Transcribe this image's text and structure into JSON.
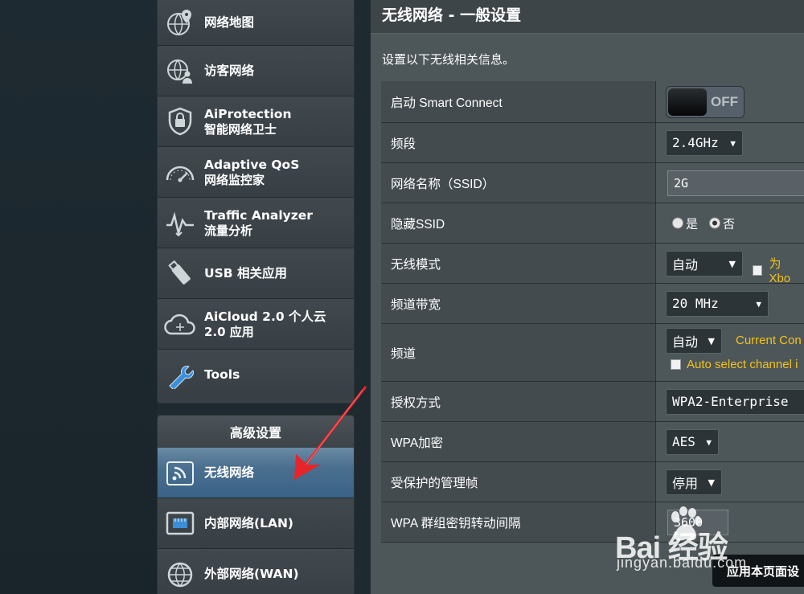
{
  "sidebar": {
    "items": [
      {
        "main": "网络地图",
        "sub": ""
      },
      {
        "main": "访客网络",
        "sub": ""
      },
      {
        "main": "AiProtection",
        "sub": "智能网络卫士"
      },
      {
        "main": "Adaptive QoS",
        "sub": "网络监控家"
      },
      {
        "main": "Traffic Analyzer",
        "sub": "流量分析"
      },
      {
        "main": "USB 相关应用",
        "sub": ""
      },
      {
        "main": "AiCloud 2.0 个人云",
        "sub": "2.0 应用"
      },
      {
        "main": "Tools",
        "sub": ""
      }
    ],
    "advanced": {
      "title": "高级设置",
      "items": [
        {
          "main": "无线网络"
        },
        {
          "main": "内部网络(LAN)"
        },
        {
          "main": "外部网络(WAN)"
        }
      ]
    }
  },
  "main": {
    "title": "无线网络 - 一般设置",
    "description": "设置以下无线相关信息。",
    "rows": {
      "smart_connect": {
        "label": "启动 Smart Connect",
        "toggle": "OFF"
      },
      "band": {
        "label": "频段",
        "value": "2.4GHz"
      },
      "ssid": {
        "label": "网络名称（SSID）",
        "value": "2G"
      },
      "hide_ssid": {
        "label": "隐藏SSID",
        "yes": "是",
        "no": "否"
      },
      "mode": {
        "label": "无线模式",
        "value": "自动",
        "check_label": "为 Xbo"
      },
      "bandwidth": {
        "label": "频道带宽",
        "value": "20 MHz"
      },
      "channel": {
        "label": "频道",
        "value": "自动",
        "current": "Current Con",
        "auto_label": "Auto select channel i"
      },
      "auth": {
        "label": "授权方式",
        "value": "WPA2-Enterprise"
      },
      "wpa_enc": {
        "label": "WPA加密",
        "value": "AES"
      },
      "pmf": {
        "label": "受保护的管理帧",
        "value": "停用"
      },
      "gtk": {
        "label": "WPA 群组密钥转动间隔",
        "value": "3600"
      }
    },
    "apply_button": "应用本页面设"
  },
  "watermark": {
    "logo": "Bai 经验",
    "sub": "jingyan.baidu.com"
  },
  "colors": {
    "accent_active": "#3a6287",
    "warning": "#f2c318"
  }
}
